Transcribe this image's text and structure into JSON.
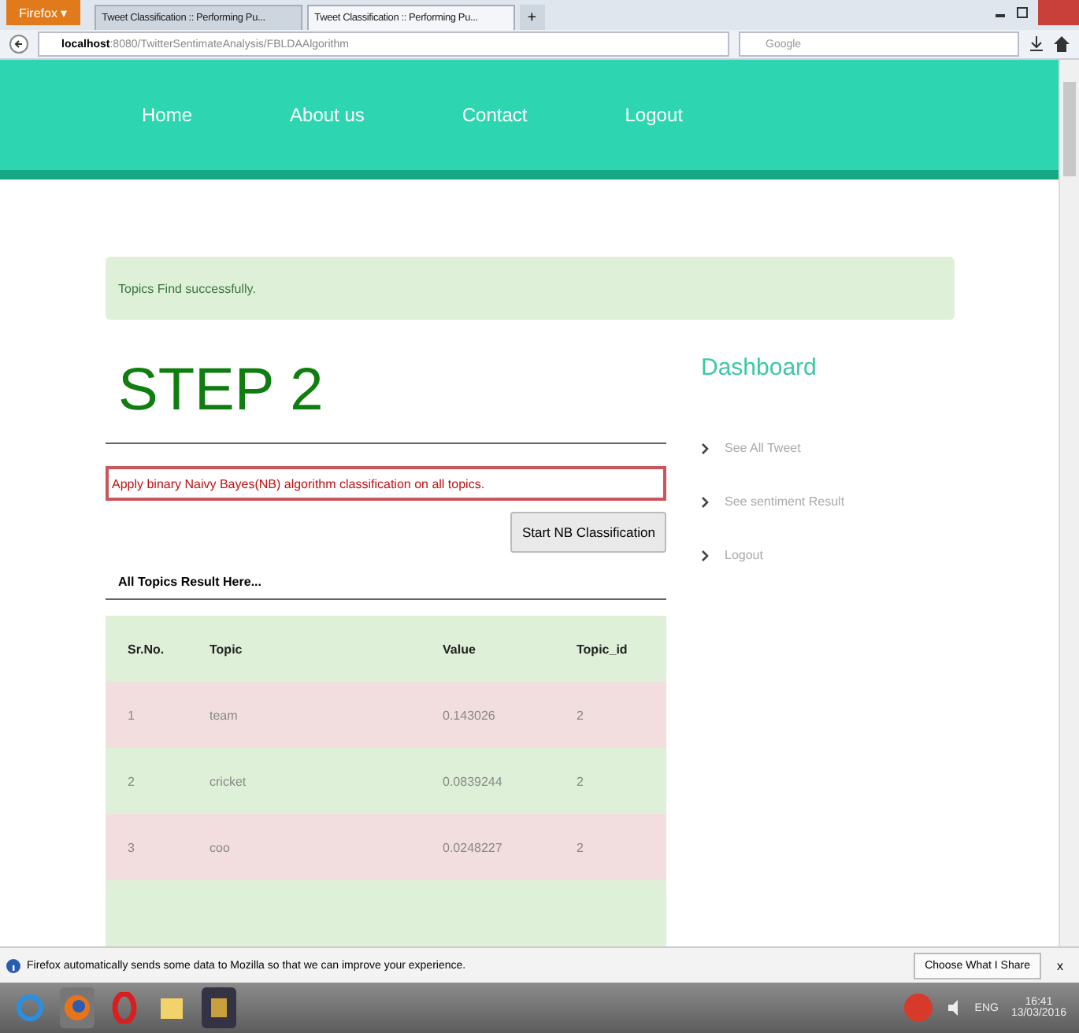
{
  "browser": {
    "menu_button": "Firefox ▾",
    "tabs": [
      {
        "label": "Tweet Classification :: Performing Pu...",
        "selected": false
      },
      {
        "label": "Tweet Classification :: Performing Pu...",
        "selected": true
      }
    ],
    "new_tab": "+",
    "url_host": "localhost",
    "url_rest": ":8080/TwitterSentimateAnalysis/FBLDAAlgorithm",
    "search_placeholder": "Google"
  },
  "nav": [
    "Home",
    "About us",
    "Contact",
    "Logout"
  ],
  "alert": "Topics Find successfully.",
  "heading": "STEP 2",
  "instruction": "Apply binary Naivy Bayes(NB) algorithm classification on all topics.",
  "action_button": "Start NB Classification",
  "results_title": "All Topics Result Here...",
  "table": {
    "columns": [
      "Sr.No.",
      "Topic",
      "Value",
      "Topic_id"
    ],
    "rows": [
      [
        "1",
        "team",
        "0.143026",
        "2"
      ],
      [
        "2",
        "cricket",
        "0.0839244",
        "2"
      ],
      [
        "3",
        "coo",
        "0.0248227",
        "2"
      ]
    ]
  },
  "dashboard": {
    "title": "Dashboard",
    "links": [
      "See All Tweet",
      "See sentiment Result",
      "Logout"
    ]
  },
  "notification": {
    "text": "Firefox automatically sends some data to Mozilla so that we can improve your experience.",
    "button": "Choose What I Share",
    "close": "x"
  },
  "taskbar": {
    "language": "ENG",
    "time": "16:41",
    "date": "13/03/2016"
  }
}
